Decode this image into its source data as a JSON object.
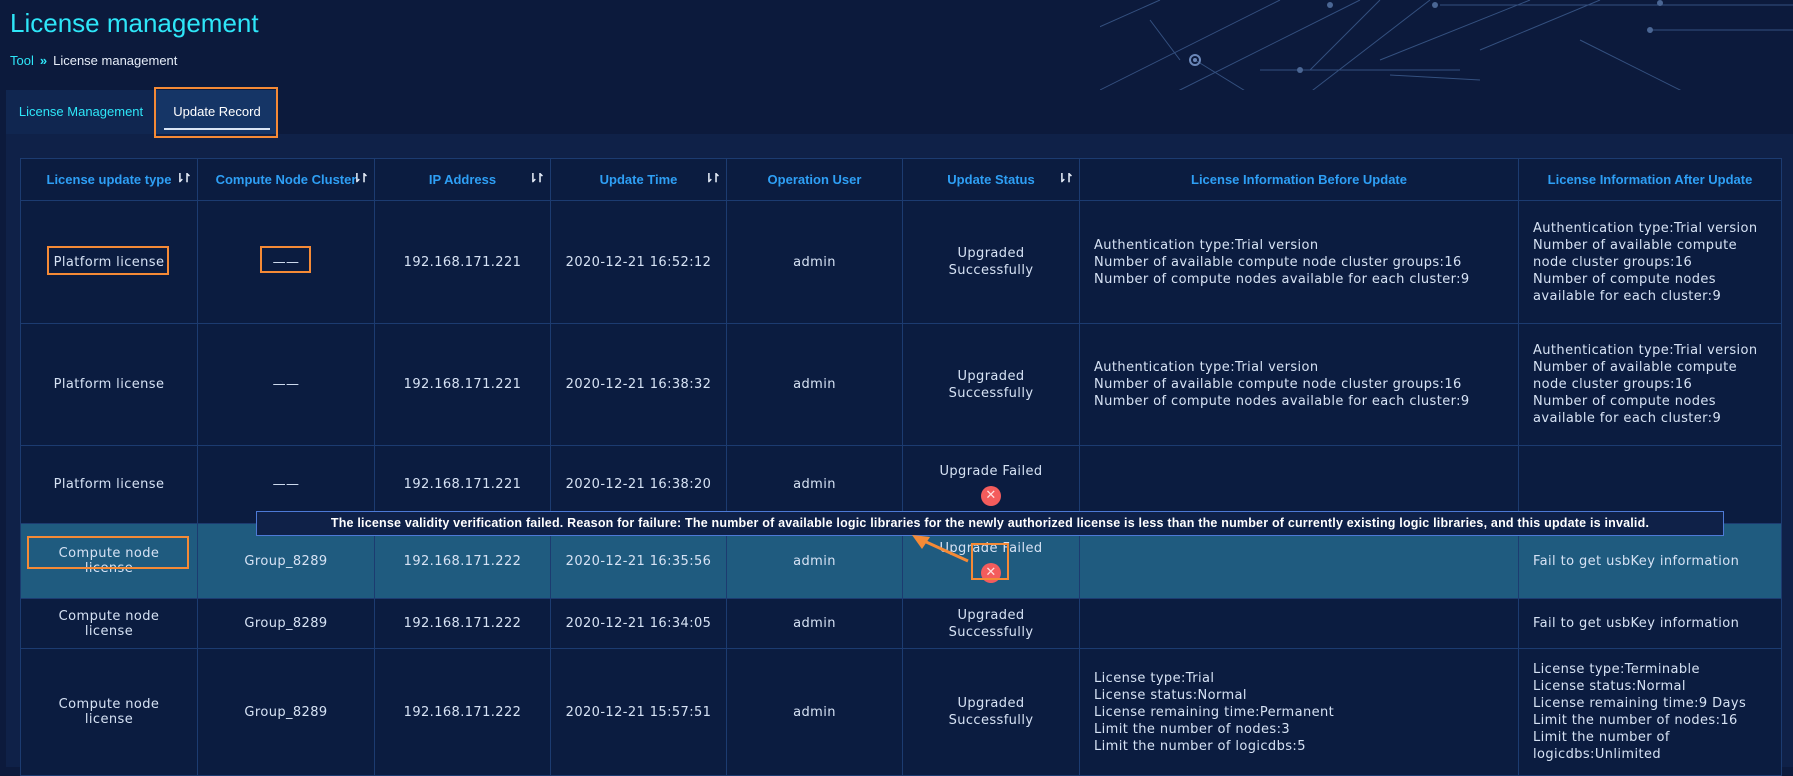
{
  "header": {
    "title": "License management",
    "breadcrumb": {
      "root": "Tool",
      "separator": "»",
      "current": "License management"
    }
  },
  "tabs": [
    {
      "label": "License Management"
    },
    {
      "label": "Update Record"
    }
  ],
  "table": {
    "columns": [
      "License update type",
      "Compute Node Cluster",
      "IP Address",
      "Update Time",
      "Operation User",
      "Update Status",
      "License Information Before Update",
      "License Information After Update"
    ],
    "rows": [
      {
        "type": "Platform license",
        "cluster": "——",
        "ip": "192.168.171.221",
        "time": "2020-12-21 16:52:12",
        "user": "admin",
        "status": [
          "Upgraded",
          "Successfully"
        ],
        "before": [
          "Authentication type:Trial version",
          "Number of available compute node cluster groups:16",
          "Number of compute nodes available for each cluster:9"
        ],
        "after": [
          "Authentication type:Trial version",
          "Number of available compute node cluster groups:16",
          "Number of compute nodes available for each cluster:9"
        ]
      },
      {
        "type": "Platform license",
        "cluster": "——",
        "ip": "192.168.171.221",
        "time": "2020-12-21 16:38:32",
        "user": "admin",
        "status": [
          "Upgraded",
          "Successfully"
        ],
        "before": [
          "Authentication type:Trial version",
          "Number of available compute node cluster groups:16",
          "Number of compute nodes available for each cluster:9"
        ],
        "after": [
          "Authentication type:Trial version",
          "Number of available compute node cluster groups:16",
          "Number of compute nodes available for each cluster:9"
        ]
      },
      {
        "type": "Platform license",
        "cluster": "——",
        "ip": "192.168.171.221",
        "time": "2020-12-21 16:38:20",
        "user": "admin",
        "status": [
          "Upgrade Failed"
        ],
        "failed": true,
        "before": [],
        "after": []
      },
      {
        "type": "Compute node license",
        "cluster": "Group_8289",
        "ip": "192.168.171.222",
        "time": "2020-12-21 16:35:56",
        "user": "admin",
        "status": [
          "Upgrade Failed"
        ],
        "failed": true,
        "before": [],
        "after": [
          "Fail to get usbKey information"
        ]
      },
      {
        "type": "Compute node license",
        "cluster": "Group_8289",
        "ip": "192.168.171.222",
        "time": "2020-12-21 16:34:05",
        "user": "admin",
        "status": [
          "Upgraded",
          "Successfully"
        ],
        "before": [],
        "after": [
          "Fail to get usbKey information"
        ]
      },
      {
        "type": "Compute node license",
        "cluster": "Group_8289",
        "ip": "192.168.171.222",
        "time": "2020-12-21 15:57:51",
        "user": "admin",
        "status": [
          "Upgraded",
          "Successfully"
        ],
        "before": [
          "License type:Trial",
          "License status:Normal",
          "License remaining time:Permanent",
          "Limit the number of nodes:3",
          "Limit the number of logicdbs:5"
        ],
        "after": [
          "License type:Terminable",
          "License status:Normal",
          "License remaining time:9 Days",
          "Limit the number of nodes:16",
          "Limit the number of logicdbs:Unlimited"
        ]
      }
    ]
  },
  "tooltip": "The license validity verification failed. Reason for failure: The number of available logic libraries for the newly authorized license is less than the number of currently existing logic libraries, and this update is invalid.",
  "icons": {
    "sort": "sort-icon",
    "fail": "close-circle-icon"
  },
  "colors": {
    "accent": "#2ee6f8",
    "header_text": "#2e9ff5",
    "highlight": "#f58a36",
    "fail": "#f45c5c",
    "active_row": "#1f5b7f"
  }
}
